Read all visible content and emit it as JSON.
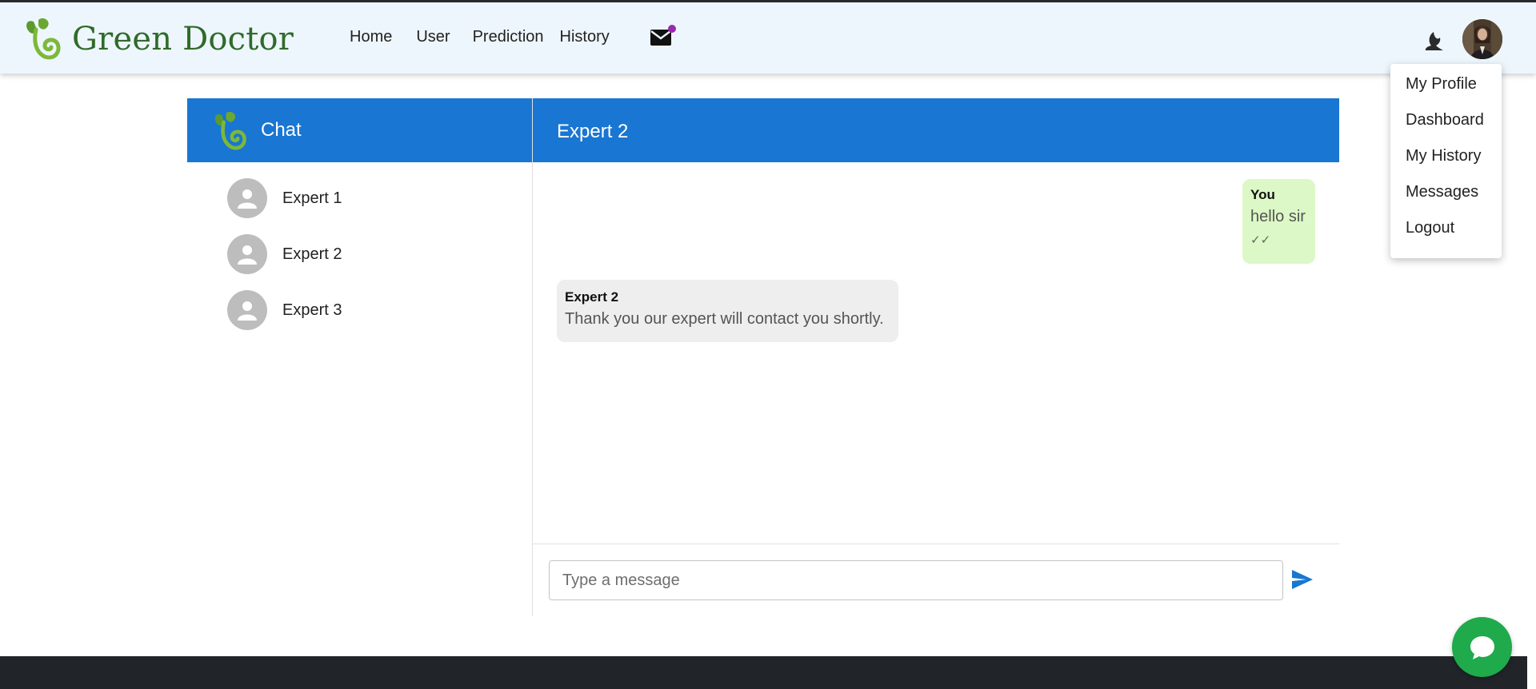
{
  "navbar": {
    "brand": "Green Doctor",
    "links": [
      "Home",
      "User",
      "Prediction",
      "History"
    ],
    "mail_unread_color": "#9c27b0"
  },
  "profile_menu": {
    "items": [
      "My Profile",
      "Dashboard",
      "My History",
      "Messages",
      "Logout"
    ]
  },
  "sidebar": {
    "title": "Chat",
    "contacts": [
      "Expert 1",
      "Expert 2",
      "Expert 3"
    ]
  },
  "chat": {
    "active_contact": "Expert 2",
    "messages": [
      {
        "sender": "You",
        "text": "hello sir",
        "status": "✓✓"
      },
      {
        "sender": "Expert 2",
        "text": "Thank you our expert will contact you shortly."
      }
    ],
    "input": {
      "placeholder": "Type a message",
      "value": ""
    }
  },
  "colors": {
    "header_blue": "#1976d2",
    "navbar_bg": "#eef6fd",
    "brand_green": "#2f6b2b",
    "own_bubble": "#dcf8c6",
    "other_bubble": "#eeeeee",
    "fab_green": "#1faa4b",
    "footer": "#212529"
  },
  "icons": {
    "logo": "sprout-leaf-logo",
    "mail": "mail-icon",
    "theme": "moon-icon",
    "send": "send-icon",
    "fab": "chat-bubble-icon",
    "contact": "person-icon"
  }
}
